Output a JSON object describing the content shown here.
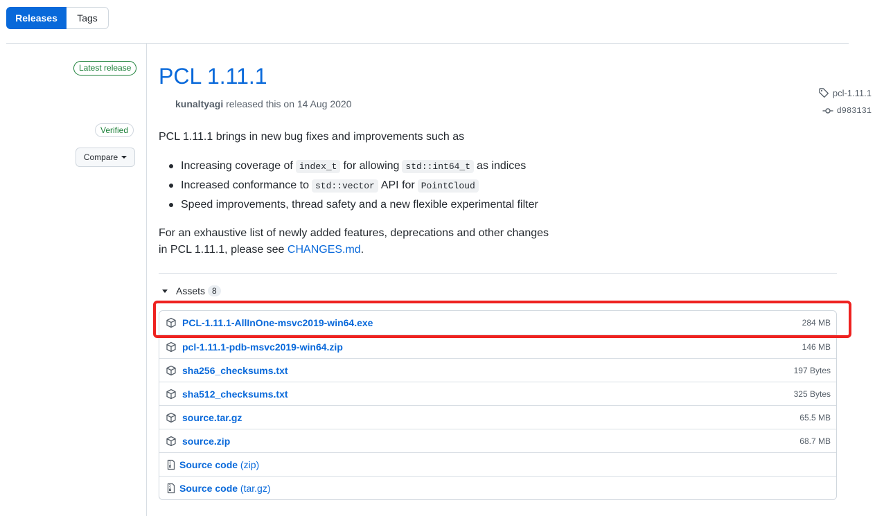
{
  "tabs": {
    "releases": "Releases",
    "tags": "Tags"
  },
  "sidebar": {
    "latest_badge": "Latest release",
    "tag": "pcl-1.11.1",
    "commit": "d983131",
    "verified": "Verified",
    "compare": "Compare"
  },
  "release": {
    "title": "PCL 1.11.1",
    "author": "kunaltyagi",
    "released_text": "released this on 14 Aug 2020",
    "intro": "PCL 1.11.1 brings in new bug fixes and improvements such as",
    "bullet1": {
      "a": "Increasing coverage of",
      "code1": "index_t",
      "b": "for allowing",
      "code2": "std::int64_t",
      "c": "as indices"
    },
    "bullet2": {
      "a": "Increased conformance to",
      "code1": "std::vector",
      "b": "API for",
      "code2": "PointCloud"
    },
    "bullet3": "Speed improvements, thread safety and a new flexible experimental filter",
    "outro_line1": "For an exhaustive list of newly added features, deprecations and other changes",
    "outro_line2": "in PCL 1.11.1, please see",
    "changes_link": "CHANGES.md",
    "outro_end": "."
  },
  "assets": {
    "label": "Assets",
    "count": "8",
    "files": [
      {
        "name": "PCL-1.11.1-AllInOne-msvc2019-win64.exe",
        "size": "284 MB"
      },
      {
        "name": "pcl-1.11.1-pdb-msvc2019-win64.zip",
        "size": "146 MB"
      },
      {
        "name": "sha256_checksums.txt",
        "size": "197 Bytes"
      },
      {
        "name": "sha512_checksums.txt",
        "size": "325 Bytes"
      },
      {
        "name": "source.tar.gz",
        "size": "65.5 MB"
      },
      {
        "name": "source.zip",
        "size": "68.7 MB"
      }
    ],
    "source_zip": {
      "name": "Source code",
      "suffix": "(zip)"
    },
    "source_targz": {
      "name": "Source code",
      "suffix": "(tar.gz)"
    }
  },
  "colors": {
    "accent": "#0969da",
    "success": "#1a7f37",
    "highlight": "#ee2220"
  }
}
